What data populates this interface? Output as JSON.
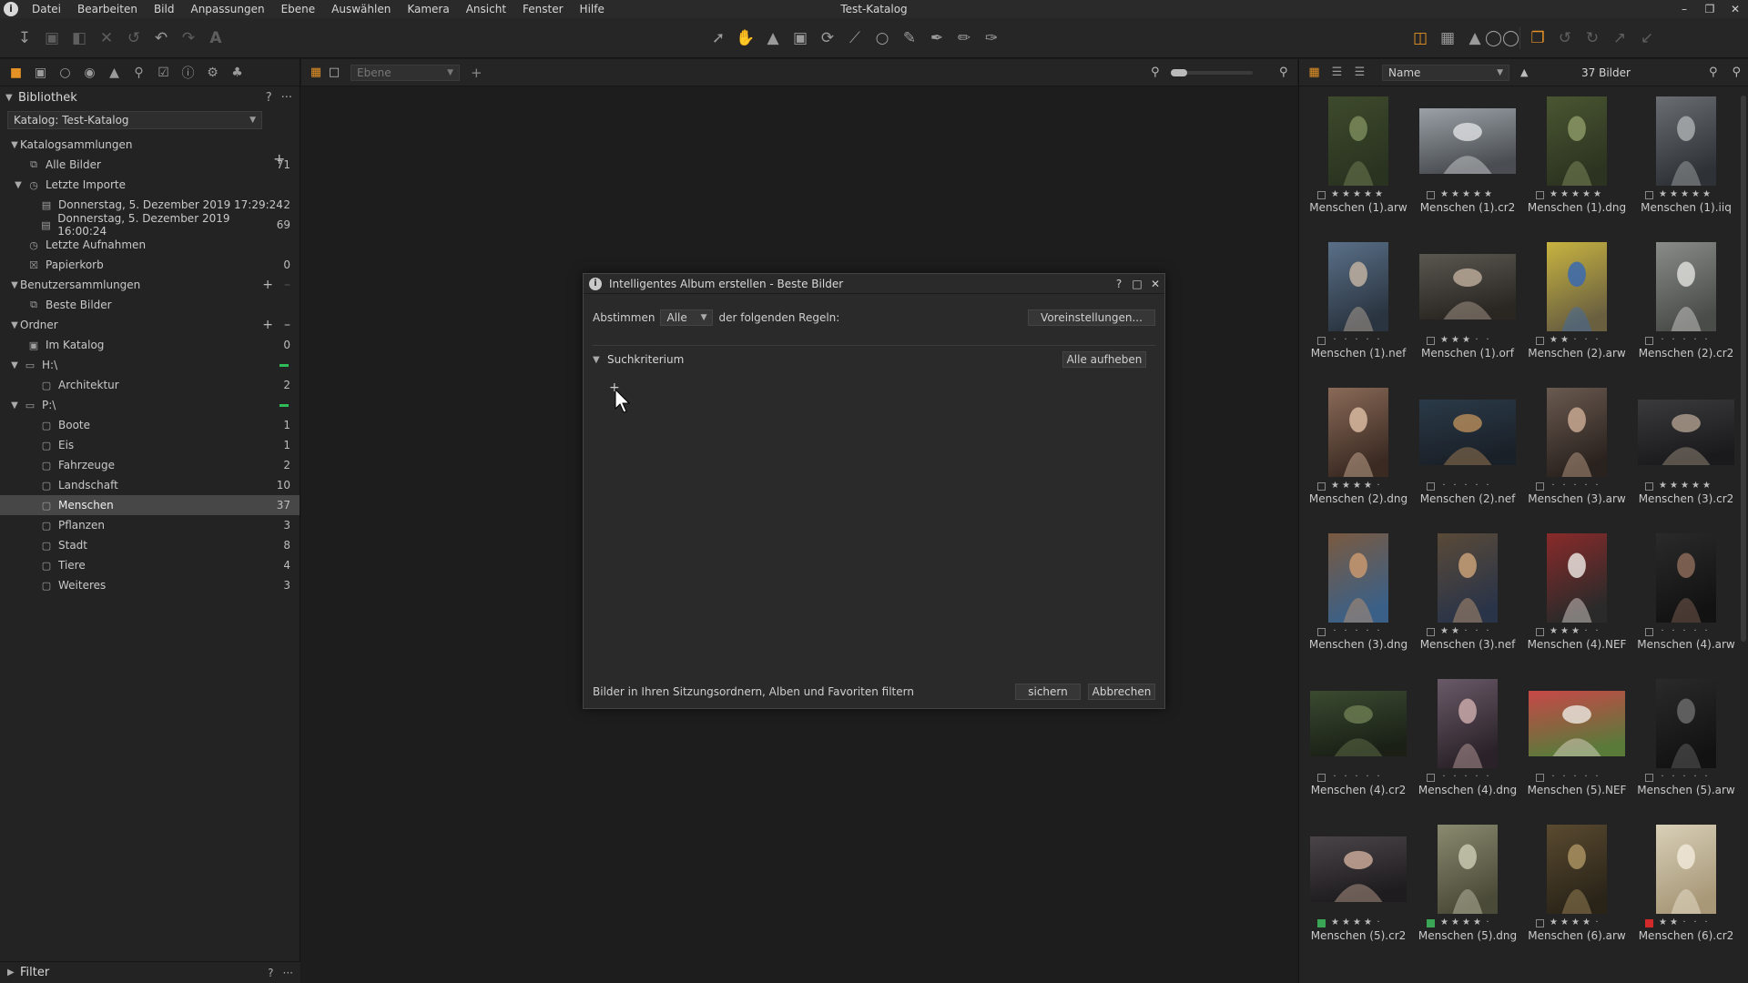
{
  "app": {
    "window_title": "Test-Katalog",
    "logo_letter": "i",
    "menu": [
      "Datei",
      "Bearbeiten",
      "Bild",
      "Anpassungen",
      "Ebene",
      "Auswählen",
      "Kamera",
      "Ansicht",
      "Fenster",
      "Hilfe"
    ]
  },
  "toolbar": {
    "left_icons": [
      "import-icon",
      "camera-icon",
      "export-icon",
      "delete-icon",
      "reset-icon",
      "undo-icon",
      "redo-icon",
      "text-icon"
    ],
    "center_icons": [
      "pointer-icon",
      "hand-icon",
      "stamp-icon",
      "crop-icon",
      "rotate-icon",
      "keystone-icon",
      "circle-icon",
      "brush-icon",
      "pen-icon",
      "eraser-icon",
      "gradient-icon"
    ],
    "right_icons": [
      "exposure-warning-icon",
      "grid-icon",
      "warning-icon",
      "glasses-icon",
      "stack-icon",
      "rotate-left-icon",
      "rotate-right-icon",
      "copy-icon",
      "apply-icon"
    ]
  },
  "library": {
    "header": "Bibliothek",
    "header_help": "?",
    "header_more": "···",
    "catalog_select": "Katalog: Test-Katalog",
    "catalog_collections": {
      "label": "Katalogsammlungen",
      "items": [
        {
          "label": "Alle Bilder",
          "count": "71",
          "icon": "images-icon"
        },
        {
          "label": "Letzte Importe",
          "count": "",
          "icon": "clock-icon",
          "expanded": true
        },
        {
          "label": "Donnerstag, 5. Dezember 2019 17:29:24",
          "count": "2",
          "icon": "import-folder-icon",
          "child": true
        },
        {
          "label": "Donnerstag, 5. Dezember 2019 16:00:24",
          "count": "69",
          "icon": "import-folder-icon",
          "child": true
        },
        {
          "label": "Letzte Aufnahmen",
          "count": "",
          "icon": "clock-icon"
        },
        {
          "label": "Papierkorb",
          "count": "0",
          "icon": "trash-icon"
        }
      ]
    },
    "user_collections": {
      "label": "Benutzersammlungen",
      "items": [
        {
          "label": "Beste Bilder",
          "count": "",
          "icon": "smart-album-icon"
        }
      ]
    },
    "folders": {
      "label": "Ordner",
      "in_catalog": {
        "label": "Im Katalog",
        "count": "0"
      },
      "drives": [
        {
          "label": "H:\\",
          "children": [
            {
              "label": "Architektur",
              "count": "2"
            }
          ]
        },
        {
          "label": "P:\\",
          "children": [
            {
              "label": "Boote",
              "count": "1"
            },
            {
              "label": "Eis",
              "count": "1"
            },
            {
              "label": "Fahrzeuge",
              "count": "2"
            },
            {
              "label": "Landschaft",
              "count": "10"
            },
            {
              "label": "Menschen",
              "count": "37",
              "selected": true
            },
            {
              "label": "Pflanzen",
              "count": "3"
            },
            {
              "label": "Stadt",
              "count": "8"
            },
            {
              "label": "Tiere",
              "count": "4"
            },
            {
              "label": "Weiteres",
              "count": "3"
            }
          ]
        }
      ]
    },
    "filter": "Filter"
  },
  "viewer": {
    "layer_select": "Ebene",
    "zoom_fraction": 0.2
  },
  "dialog": {
    "title": "Intelligentes Album erstellen - Beste Bilder",
    "match_label": "Abstimmen",
    "match_value": "Alle",
    "match_suffix": "der folgenden Regeln:",
    "presets_button": "Voreinstellungen...",
    "criteria_label": "Suchkriterium",
    "clear_all_button": "Alle aufheben",
    "add_rule": "+",
    "footer_text": "Bilder in Ihren Sitzungsordnern, Alben und Favoriten filtern",
    "save_button": "sichern",
    "cancel_button": "Abbrechen"
  },
  "browser": {
    "sort_select": "Name",
    "image_count": "37 Bilder",
    "thumbnails": [
      {
        "name": "Menschen (1).arw",
        "rating": 5,
        "label": "none",
        "colors": [
          "#3e4a2c",
          "#7a8a5a",
          "#2a3320"
        ],
        "orient": "portrait"
      },
      {
        "name": "Menschen (1).cr2",
        "rating": 5,
        "label": "none",
        "colors": [
          "#9aa0a6",
          "#d8dadc",
          "#4a4e52"
        ],
        "orient": "landscape"
      },
      {
        "name": "Menschen (1).dng",
        "rating": 5,
        "label": "none",
        "colors": [
          "#4a5632",
          "#8a9664",
          "#2c3320"
        ],
        "orient": "portrait"
      },
      {
        "name": "Menschen (1).iiq",
        "rating": 5,
        "label": "none",
        "colors": [
          "#6a6e72",
          "#a8acae",
          "#2e3236"
        ],
        "orient": "portrait"
      },
      {
        "name": "Menschen (1).nef",
        "rating": 0,
        "label": "none",
        "colors": [
          "#5a7088",
          "#c0b0a0",
          "#2a3440"
        ],
        "orient": "portrait"
      },
      {
        "name": "Menschen (1).orf",
        "rating": 3,
        "label": "none",
        "colors": [
          "#5a5650",
          "#b8a898",
          "#2a2622"
        ],
        "orient": "landscape"
      },
      {
        "name": "Menschen (2).arw",
        "rating": 2,
        "label": "none",
        "colors": [
          "#c8b440",
          "#3a6ab0",
          "#6a6040"
        ],
        "orient": "portrait"
      },
      {
        "name": "Menschen (2).cr2",
        "rating": 0,
        "label": "none",
        "colors": [
          "#8a8c8a",
          "#dcdcd8",
          "#4a4c4a"
        ],
        "orient": "portrait"
      },
      {
        "name": "Menschen (2).dng",
        "rating": 4,
        "label": "none",
        "colors": [
          "#8a6a58",
          "#d8b8a0",
          "#3a2a22"
        ],
        "orient": "portrait"
      },
      {
        "name": "Menschen (2).nef",
        "rating": 0,
        "label": "none",
        "colors": [
          "#2a3a48",
          "#b08858",
          "#1a2028"
        ],
        "orient": "landscape"
      },
      {
        "name": "Menschen (3).arw",
        "rating": 0,
        "label": "none",
        "colors": [
          "#6a5a50",
          "#c8a890",
          "#2a221e"
        ],
        "orient": "portrait"
      },
      {
        "name": "Menschen (3).cr2",
        "rating": 5,
        "label": "none",
        "colors": [
          "#3a3a3c",
          "#a89888",
          "#1a1a1c"
        ],
        "orient": "landscape"
      },
      {
        "name": "Menschen (3).dng",
        "rating": 0,
        "label": "none",
        "colors": [
          "#7a5a40",
          "#c89870",
          "#3a6088"
        ],
        "orient": "portrait"
      },
      {
        "name": "Menschen (3).nef",
        "rating": 2,
        "label": "none",
        "colors": [
          "#5a4a38",
          "#c8a078",
          "#2a3448"
        ],
        "orient": "portrait"
      },
      {
        "name": "Menschen (4).NEF",
        "rating": 3,
        "label": "none",
        "colors": [
          "#8a2a2a",
          "#e8e0dc",
          "#2a2a2a"
        ],
        "orient": "portrait"
      },
      {
        "name": "Menschen (4).arw",
        "rating": 0,
        "label": "none",
        "colors": [
          "#2a2a2a",
          "#8a6a58",
          "#121212"
        ],
        "orient": "portrait"
      },
      {
        "name": "Menschen (4).cr2",
        "rating": 0,
        "label": "none",
        "colors": [
          "#3a4a30",
          "#6a7a50",
          "#1a2016"
        ],
        "orient": "landscape"
      },
      {
        "name": "Menschen (4).dng",
        "rating": 0,
        "label": "none",
        "colors": [
          "#6a5a68",
          "#c8a8a8",
          "#2a2228"
        ],
        "orient": "portrait"
      },
      {
        "name": "Menschen (5).NEF",
        "rating": 0,
        "label": "none",
        "colors": [
          "#c84848",
          "#e8e0d8",
          "#5a7a3a"
        ],
        "orient": "landscape"
      },
      {
        "name": "Menschen (5).arw",
        "rating": 0,
        "label": "none",
        "colors": [
          "#2a2a2a",
          "#6a6a6a",
          "#121212"
        ],
        "orient": "portrait"
      },
      {
        "name": "Menschen (5).cr2",
        "rating": 4,
        "label": "green",
        "colors": [
          "#4a4448",
          "#c8a898",
          "#1e1c1e"
        ],
        "orient": "landscape"
      },
      {
        "name": "Menschen (5).dng",
        "rating": 4,
        "label": "green",
        "colors": [
          "#8a8a70",
          "#c8c8b0",
          "#4a4a38"
        ],
        "orient": "portrait"
      },
      {
        "name": "Menschen (6).arw",
        "rating": 4,
        "label": "none",
        "colors": [
          "#5a4a30",
          "#a89060",
          "#2a2418"
        ],
        "orient": "portrait"
      },
      {
        "name": "Menschen (6).cr2",
        "rating": 2,
        "label": "red",
        "colors": [
          "#d8d0b8",
          "#f0e8d8",
          "#a89878"
        ],
        "orient": "portrait"
      }
    ]
  },
  "colors": {
    "accent": "#e49226",
    "selection": "#474747",
    "status_green": "#2fbd57"
  }
}
